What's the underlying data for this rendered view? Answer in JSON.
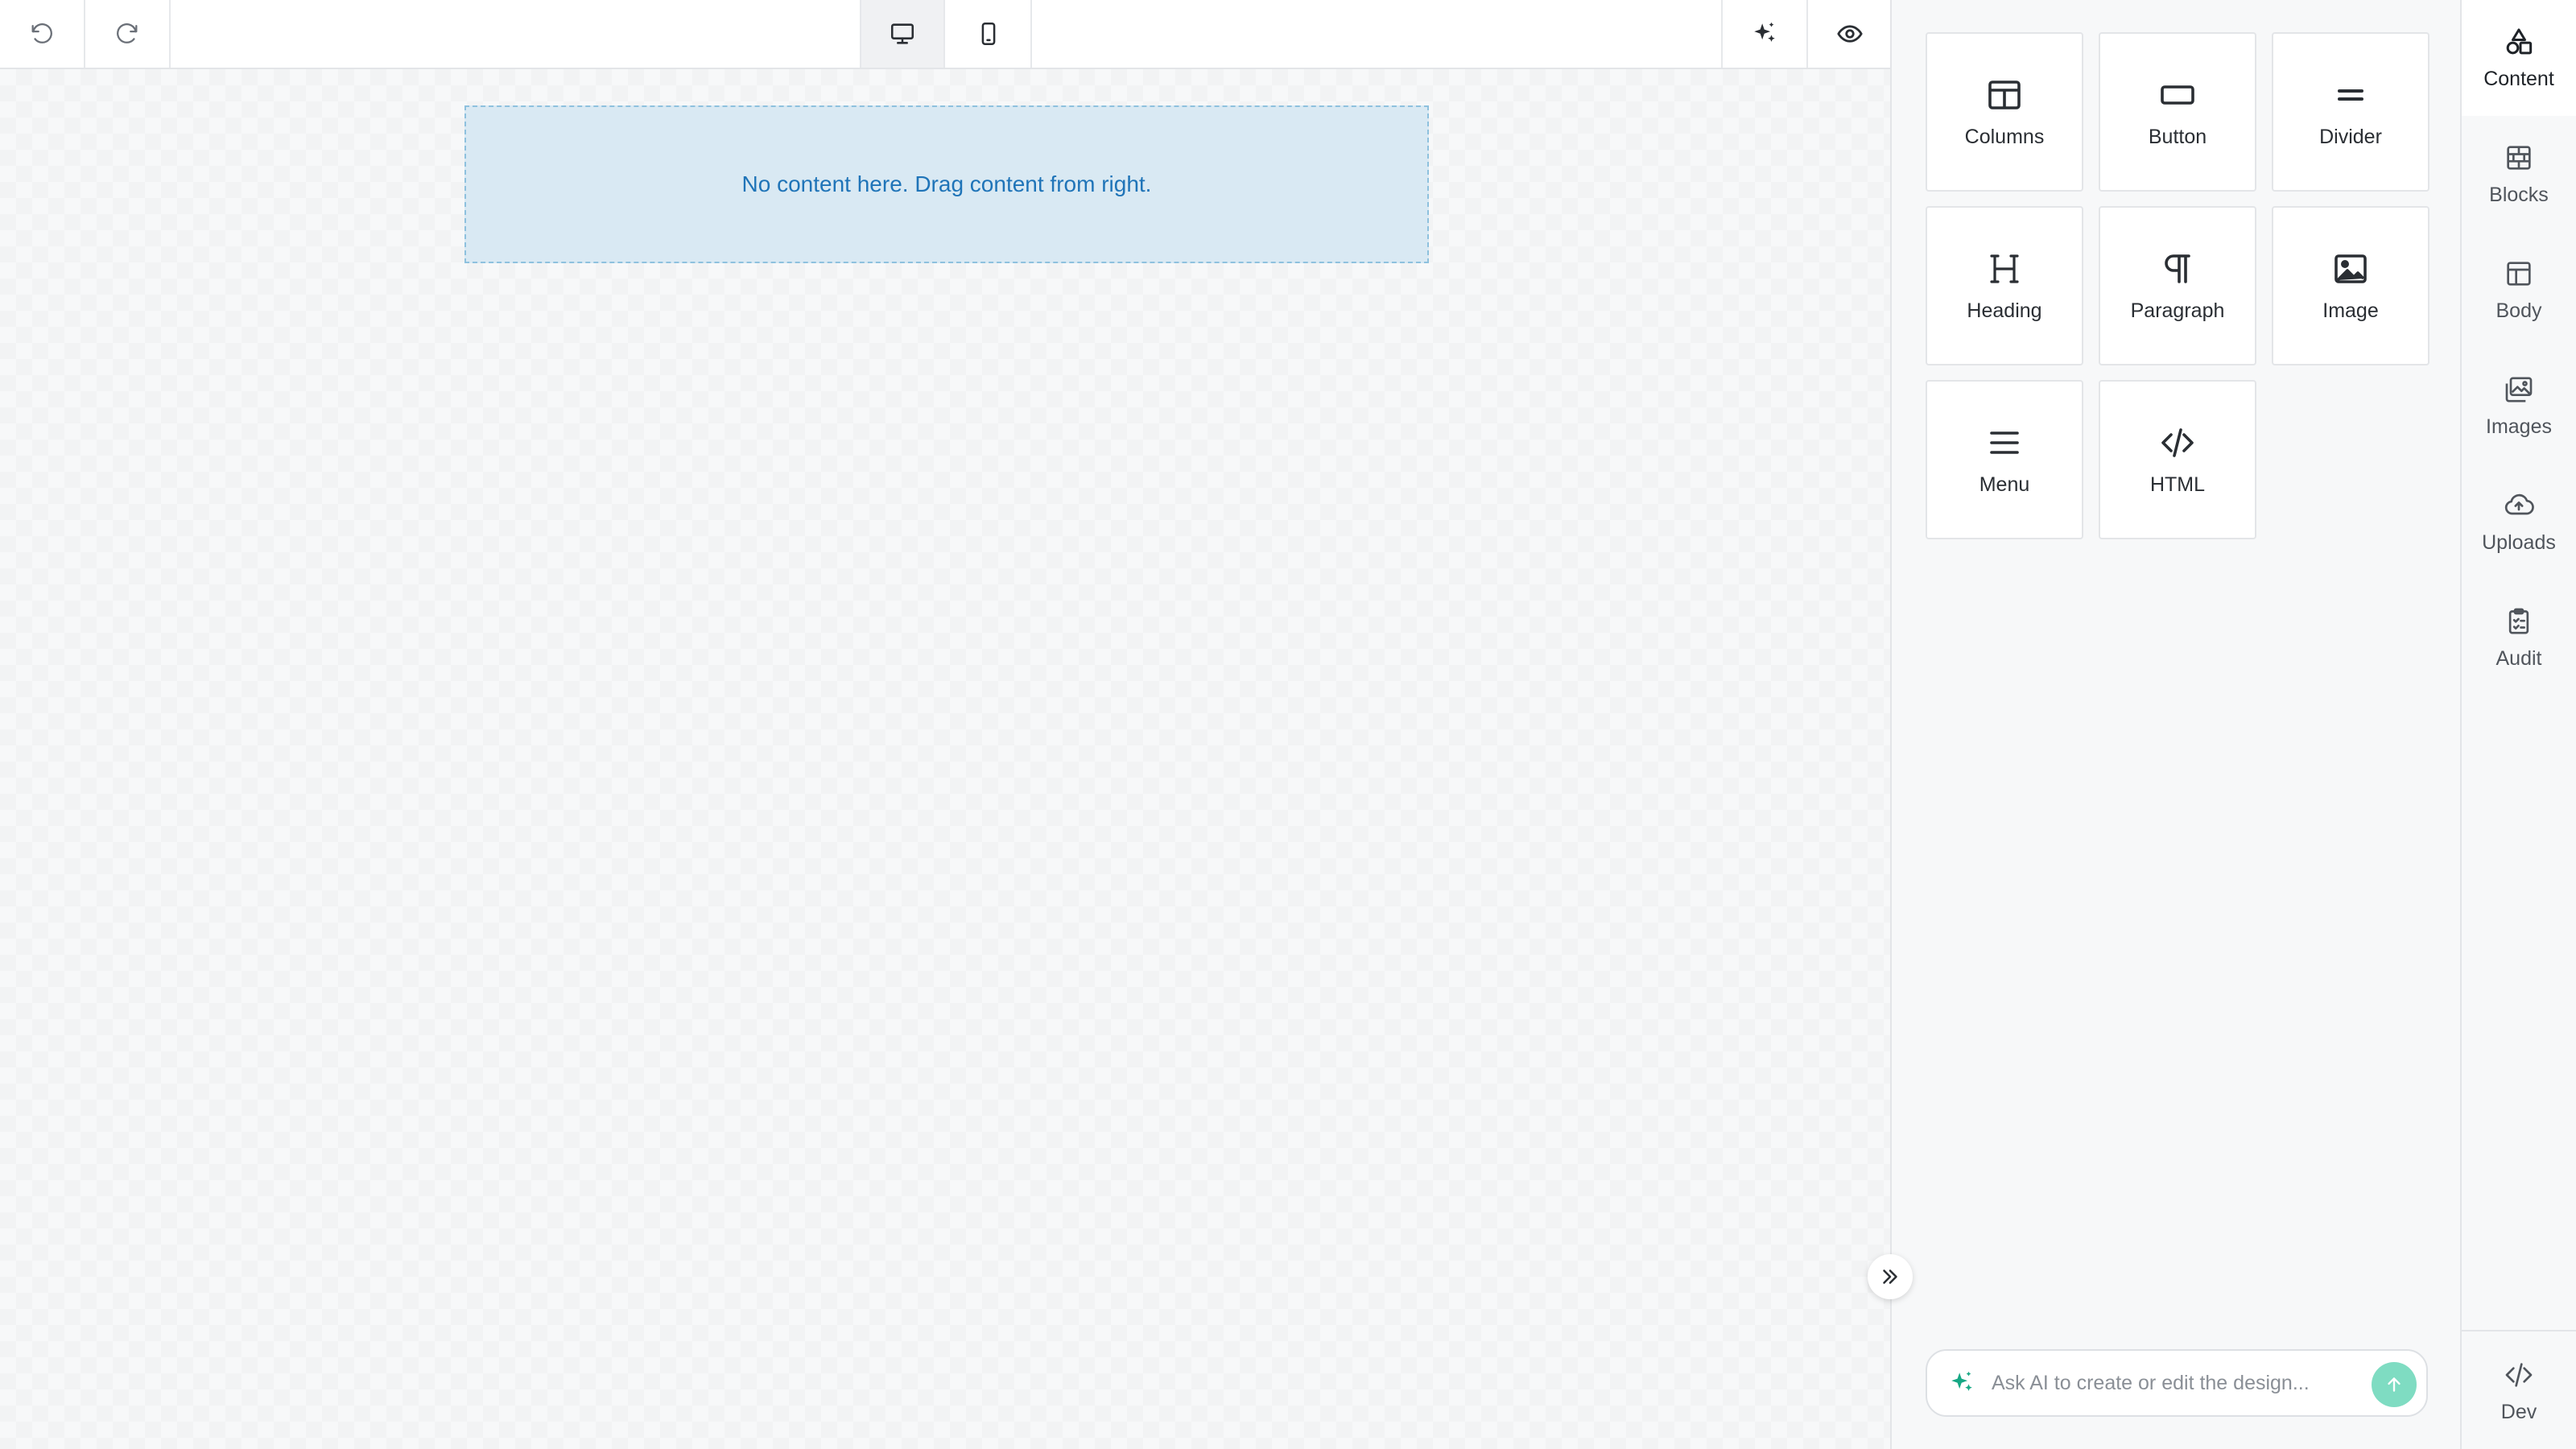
{
  "toolbar": {
    "undo_icon": "undo-icon",
    "redo_icon": "redo-icon",
    "desktop_icon": "monitor-icon",
    "mobile_icon": "smartphone-icon",
    "magic_icon": "sparkle-icon",
    "preview_icon": "eye-icon",
    "active_device": "desktop"
  },
  "canvas": {
    "empty_message": "No content here. Drag content from right."
  },
  "content_tiles": [
    {
      "label": "Columns",
      "icon": "columns-icon"
    },
    {
      "label": "Button",
      "icon": "button-icon"
    },
    {
      "label": "Divider",
      "icon": "divider-icon"
    },
    {
      "label": "Heading",
      "icon": "heading-icon"
    },
    {
      "label": "Paragraph",
      "icon": "paragraph-icon"
    },
    {
      "label": "Image",
      "icon": "image-icon"
    },
    {
      "label": "Menu",
      "icon": "menu-icon"
    },
    {
      "label": "HTML",
      "icon": "code-icon"
    }
  ],
  "ai": {
    "placeholder": "Ask AI to create or edit the design...",
    "accent": "#17a885"
  },
  "sidenav": {
    "items": [
      {
        "label": "Content",
        "icon": "shapes-icon",
        "active": true
      },
      {
        "label": "Blocks",
        "icon": "blocks-icon"
      },
      {
        "label": "Body",
        "icon": "layout-icon"
      },
      {
        "label": "Images",
        "icon": "images-icon"
      },
      {
        "label": "Uploads",
        "icon": "cloud-upload-icon"
      },
      {
        "label": "Audit",
        "icon": "clipboard-check-icon"
      }
    ],
    "dev": {
      "label": "Dev",
      "icon": "code-icon"
    }
  },
  "colors": {
    "dropzone_bg": "#d9e9f3",
    "dropzone_border": "#8ec1de",
    "dropzone_text": "#1f74b8"
  }
}
